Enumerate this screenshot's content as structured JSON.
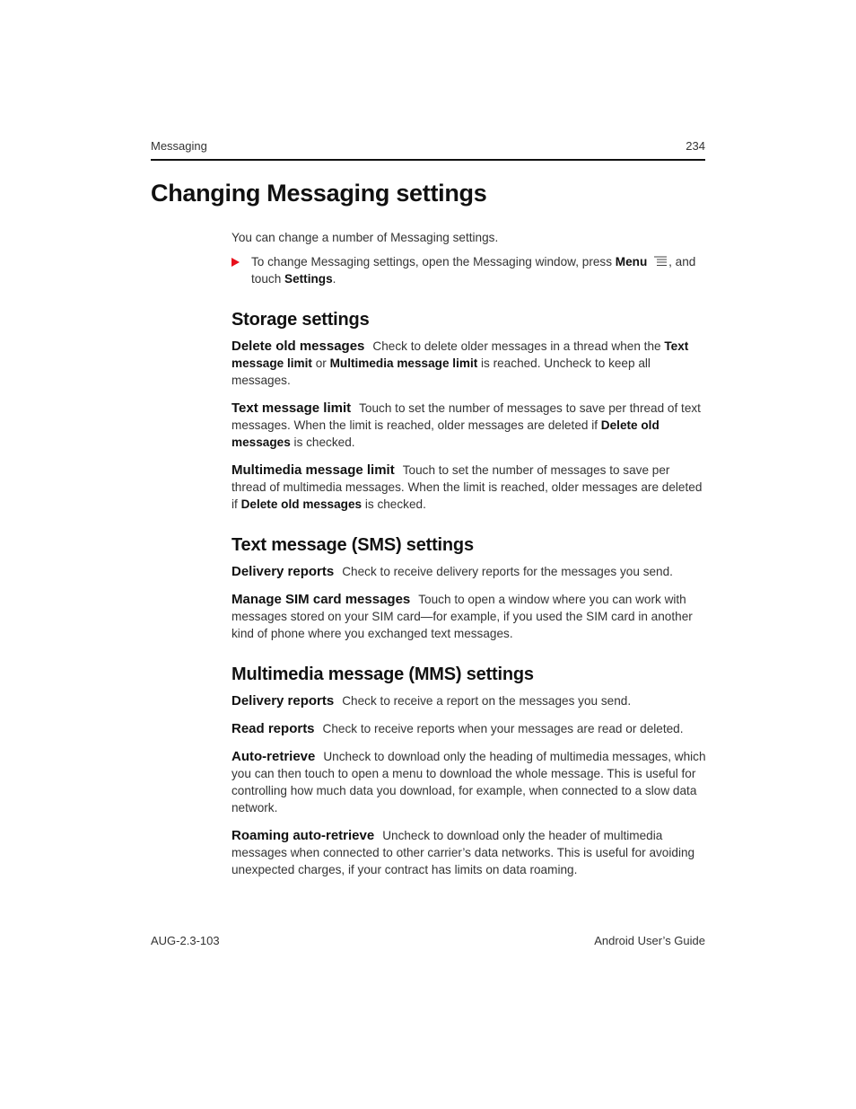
{
  "header": {
    "section": "Messaging",
    "page_number": "234"
  },
  "title": "Changing Messaging settings",
  "intro": "You can change a number of Messaging settings.",
  "step": {
    "text1": "To change Messaging settings, open the Messaging window, press ",
    "menu_label": "Menu",
    "icon": "menu-icon",
    "text2": ", and touch ",
    "settings_label": "Settings",
    "text3": "."
  },
  "sections": {
    "storage": {
      "heading": "Storage settings",
      "delete_old": {
        "term": "Delete old messages",
        "t1": "Check to delete older messages in a thread when the ",
        "b1": "Text message limit",
        "t2": " or ",
        "b2": "Multimedia message limit",
        "t3": " is reached. Uncheck to keep all messages."
      },
      "text_limit": {
        "term": "Text message limit",
        "t1": "Touch to set the number of messages to save per thread of text messages. When the limit is reached, older messages are deleted if ",
        "b1": "Delete old messages",
        "t2": " is checked."
      },
      "mm_limit": {
        "term": "Multimedia message limit",
        "t1": "Touch to set the number of messages to save per thread of multimedia messages. When the limit is reached, older messages are deleted if ",
        "b1": "Delete old messages",
        "t2": " is checked."
      }
    },
    "sms": {
      "heading": "Text message (SMS) settings",
      "delivery": {
        "term": "Delivery reports",
        "text": "Check to receive delivery reports for the messages you send."
      },
      "sim": {
        "term": "Manage SIM card messages",
        "text": "Touch to open a window where you can work with messages stored on your SIM card—for example, if you used the SIM card in another kind of phone where you exchanged text messages."
      }
    },
    "mms": {
      "heading": "Multimedia message (MMS) settings",
      "delivery": {
        "term": "Delivery reports",
        "text": "Check to receive a report on the messages you send."
      },
      "read": {
        "term": "Read reports",
        "text": "Check to receive reports when your messages are read or deleted."
      },
      "auto": {
        "term": "Auto-retrieve",
        "text": "Uncheck to download only the heading of multimedia messages, which you can then touch to open a menu to download the whole message. This is useful for controlling how much data you download, for example, when connected to a slow data network."
      },
      "roaming": {
        "term": "Roaming auto-retrieve",
        "text": "Uncheck to download only the header of multimedia messages when connected to other carrier’s data networks. This is useful for avoiding unexpected charges, if your contract has limits on data roaming."
      }
    }
  },
  "footer": {
    "doc_id": "AUG-2.3-103",
    "guide_name": "Android User’s Guide"
  },
  "colors": {
    "bullet": "#e8101c",
    "rule": "#111111"
  }
}
